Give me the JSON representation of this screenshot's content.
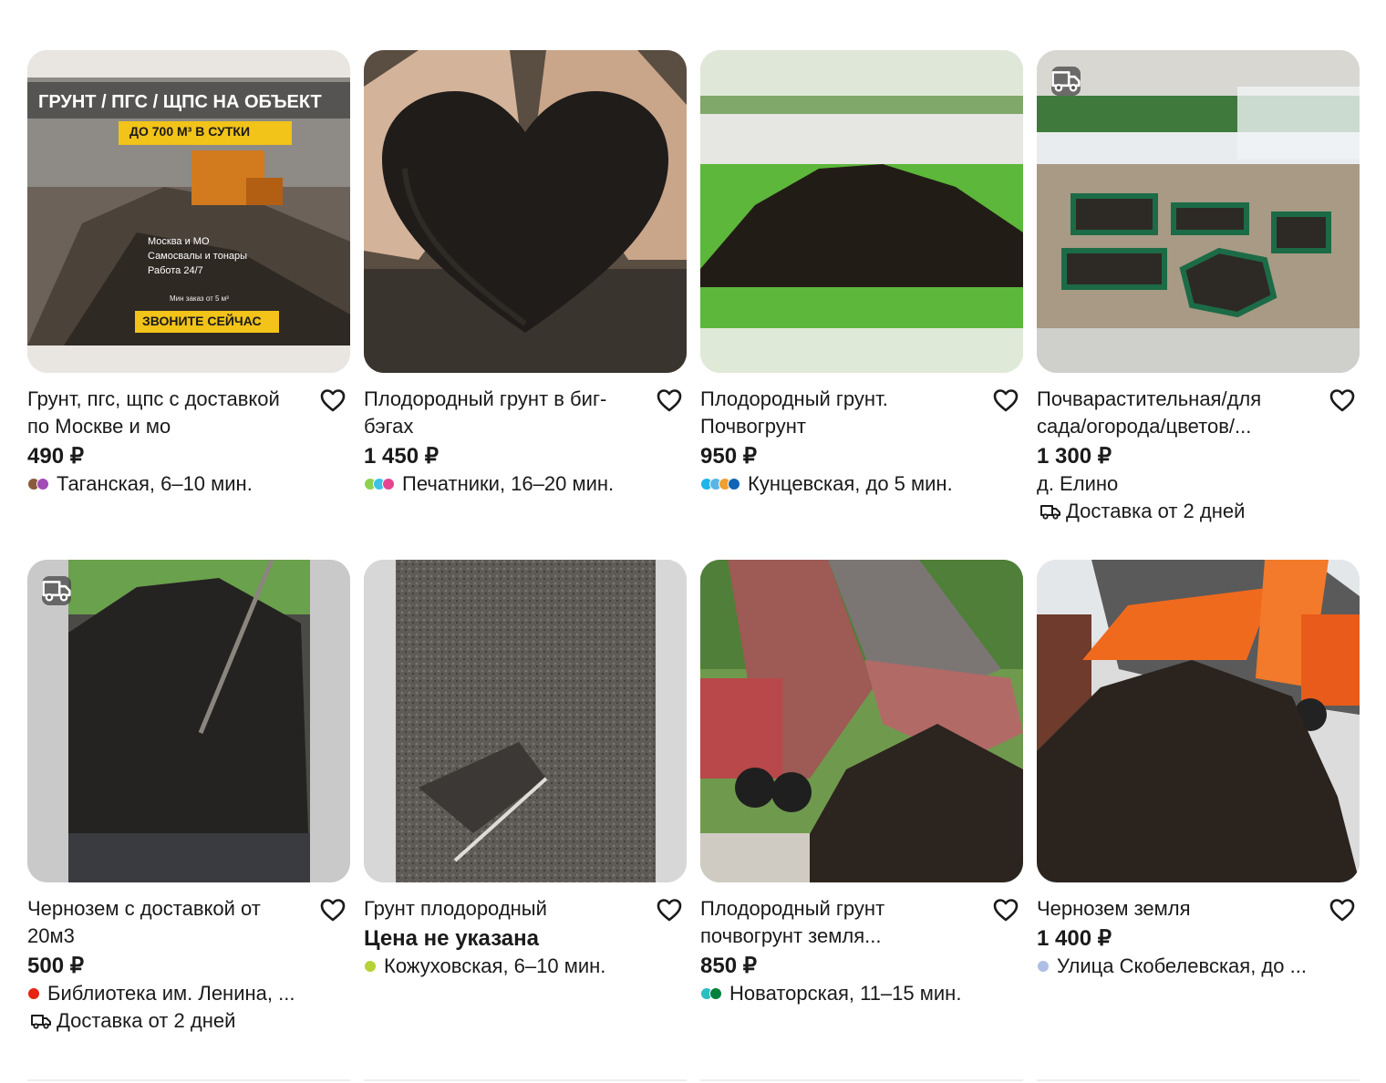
{
  "listings": [
    {
      "title": "Грунт, пгс, щпс с доставкой по Москве и мо",
      "price": "490 ₽",
      "location": "Таганская, 6–10 мин.",
      "metro_colors": [
        "#8b5a3c",
        "#a34bb6"
      ],
      "delivery": "",
      "image": "poster-soil-excavator",
      "has_delivery_chip": false,
      "poster": {
        "headline": "ГРУНТ / ПГС / ЩПС НА ОБЪЕКТ",
        "badge": "ДО 700 М³ В СУТКИ",
        "items": [
          "Москва и МО",
          "Самосвалы и тонары",
          "Работа 24/7"
        ],
        "min": "Мин заказ от 5 м³",
        "cta": "ЗВОНИТЕ СЕЙЧАС"
      }
    },
    {
      "title": "Плодородный грунт в биг-бэгах",
      "price": "1 450 ₽",
      "location": "Печатники, 16–20 мин.",
      "metro_colors": [
        "#8fd14f",
        "#3ec1e6",
        "#e84393"
      ],
      "delivery": "",
      "image": "soil-heart-hands",
      "has_delivery_chip": false
    },
    {
      "title": "Плодородный грунт. Почвогрунт",
      "price": "950 ₽",
      "location": "Кунцевская, до 5 мин.",
      "metro_colors": [
        "#1fb5e8",
        "#5ab4e5",
        "#f0a030",
        "#1163b7"
      ],
      "delivery": "",
      "image": "soil-pile-lawn",
      "has_delivery_chip": false
    },
    {
      "title": "Почварастительная/для сада/огорода/цветов/...",
      "price": "1 300 ₽",
      "location": "д. Елино",
      "metro_colors": [],
      "delivery": "Доставка от 2 дней",
      "image": "garden-beds",
      "has_delivery_chip": true
    },
    {
      "title": "Чернозем с доставкой от 20м3",
      "price": "500 ₽",
      "location": "Библиотека им. Ленина, ...",
      "metro_colors": [
        "#e42313"
      ],
      "delivery": "Доставка от 2 дней",
      "image": "black-soil-shovel",
      "has_delivery_chip": true
    },
    {
      "title": "Грунт плодородный",
      "price": "Цена не указана",
      "location": "Кожуховская, 6–10 мин.",
      "metro_colors": [
        "#b5d334"
      ],
      "delivery": "",
      "image": "soil-closeup",
      "has_delivery_chip": false
    },
    {
      "title": "Плодородный грунт почвогрунт земля...",
      "price": "850 ₽",
      "location": "Новаторская, 11–15 мин.",
      "metro_colors": [
        "#2dbec1",
        "#00803a"
      ],
      "delivery": "",
      "image": "truck-dumping-red",
      "has_delivery_chip": false
    },
    {
      "title": "Чернозем земля",
      "price": "1 400 ₽",
      "location": "Улица Скобелевская, до ...",
      "metro_colors": [
        "#adbfe4"
      ],
      "delivery": "",
      "image": "truck-dumping-orange",
      "has_delivery_chip": false
    }
  ]
}
